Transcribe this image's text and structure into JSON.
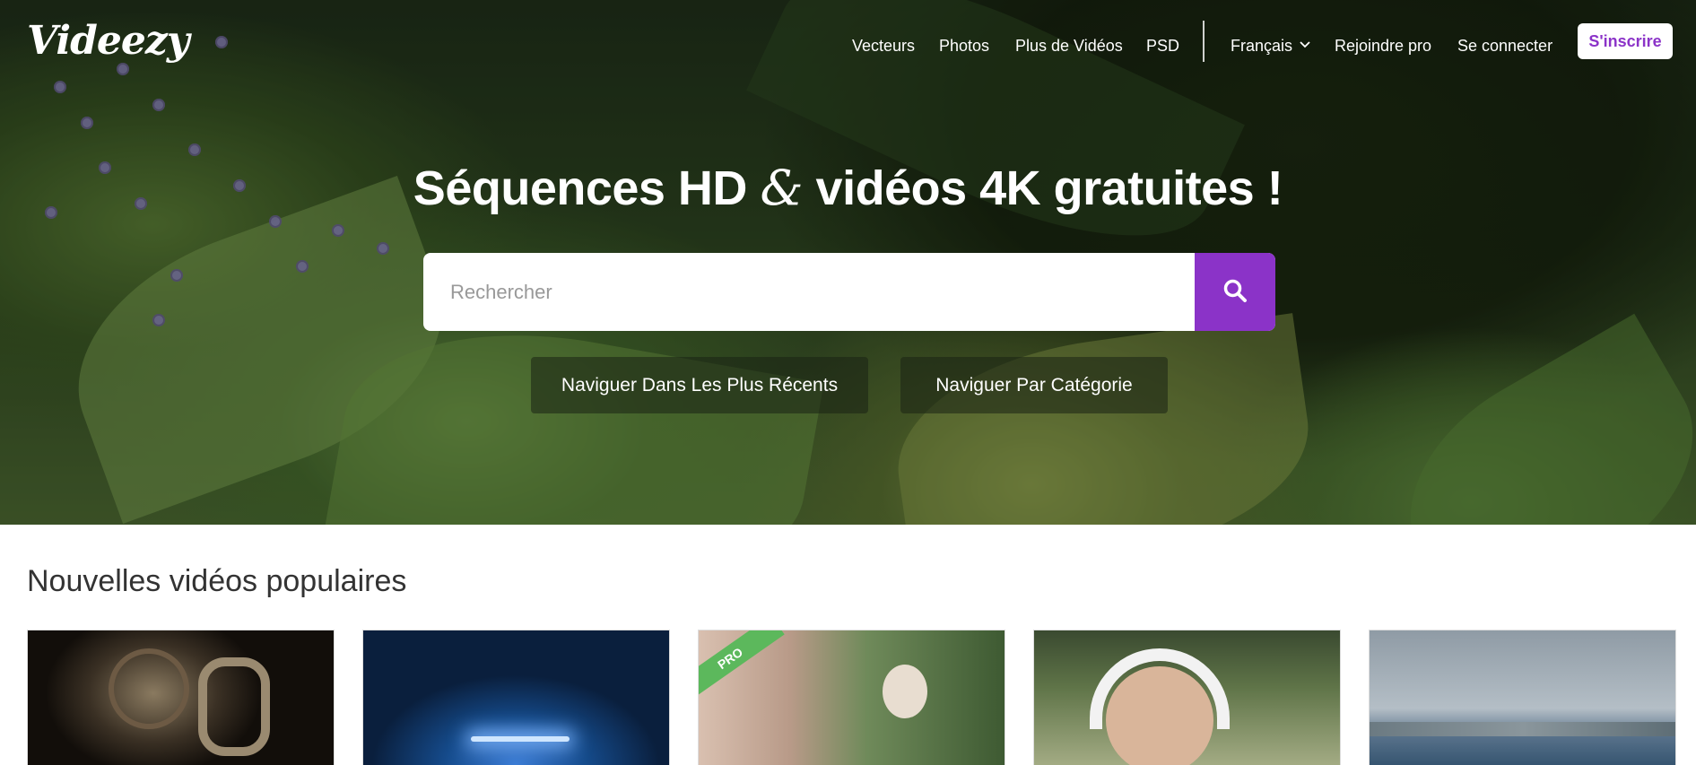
{
  "brand": {
    "logo": "Videezy",
    "accent": "#8b33c8",
    "pro_color": "#5cb85c"
  },
  "nav": {
    "vectors": "Vecteurs",
    "photos": "Photos",
    "more_videos": "Plus de Vidéos",
    "psd": "PSD",
    "language": "Français",
    "join_pro": "Rejoindre pro",
    "login": "Se connecter",
    "signup": "S'inscrire"
  },
  "hero": {
    "title_part1": "Séquences HD",
    "title_amp": "&",
    "title_part2": "vidéos 4K gratuites !",
    "search_placeholder": "Rechercher",
    "search_icon": "search-icon",
    "browse_recent": "Naviguer Dans Les Plus Récents",
    "browse_category": "Naviguer Par Catégorie"
  },
  "section": {
    "title": "Nouvelles vidéos populaires",
    "pro_badge": "PRO"
  }
}
